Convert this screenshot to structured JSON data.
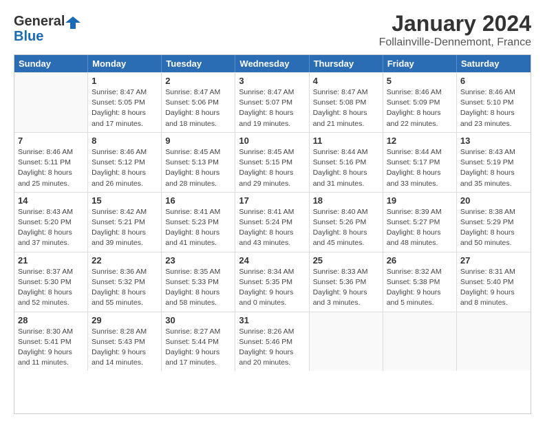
{
  "logo": {
    "general": "General",
    "blue": "Blue"
  },
  "title": "January 2024",
  "subtitle": "Follainville-Dennemont, France",
  "days": [
    "Sunday",
    "Monday",
    "Tuesday",
    "Wednesday",
    "Thursday",
    "Friday",
    "Saturday"
  ],
  "weeks": [
    [
      {
        "num": "",
        "sunrise": "",
        "sunset": "",
        "daylight": ""
      },
      {
        "num": "1",
        "sunrise": "Sunrise: 8:47 AM",
        "sunset": "Sunset: 5:05 PM",
        "daylight": "Daylight: 8 hours and 17 minutes."
      },
      {
        "num": "2",
        "sunrise": "Sunrise: 8:47 AM",
        "sunset": "Sunset: 5:06 PM",
        "daylight": "Daylight: 8 hours and 18 minutes."
      },
      {
        "num": "3",
        "sunrise": "Sunrise: 8:47 AM",
        "sunset": "Sunset: 5:07 PM",
        "daylight": "Daylight: 8 hours and 19 minutes."
      },
      {
        "num": "4",
        "sunrise": "Sunrise: 8:47 AM",
        "sunset": "Sunset: 5:08 PM",
        "daylight": "Daylight: 8 hours and 21 minutes."
      },
      {
        "num": "5",
        "sunrise": "Sunrise: 8:46 AM",
        "sunset": "Sunset: 5:09 PM",
        "daylight": "Daylight: 8 hours and 22 minutes."
      },
      {
        "num": "6",
        "sunrise": "Sunrise: 8:46 AM",
        "sunset": "Sunset: 5:10 PM",
        "daylight": "Daylight: 8 hours and 23 minutes."
      }
    ],
    [
      {
        "num": "7",
        "sunrise": "Sunrise: 8:46 AM",
        "sunset": "Sunset: 5:11 PM",
        "daylight": "Daylight: 8 hours and 25 minutes."
      },
      {
        "num": "8",
        "sunrise": "Sunrise: 8:46 AM",
        "sunset": "Sunset: 5:12 PM",
        "daylight": "Daylight: 8 hours and 26 minutes."
      },
      {
        "num": "9",
        "sunrise": "Sunrise: 8:45 AM",
        "sunset": "Sunset: 5:13 PM",
        "daylight": "Daylight: 8 hours and 28 minutes."
      },
      {
        "num": "10",
        "sunrise": "Sunrise: 8:45 AM",
        "sunset": "Sunset: 5:15 PM",
        "daylight": "Daylight: 8 hours and 29 minutes."
      },
      {
        "num": "11",
        "sunrise": "Sunrise: 8:44 AM",
        "sunset": "Sunset: 5:16 PM",
        "daylight": "Daylight: 8 hours and 31 minutes."
      },
      {
        "num": "12",
        "sunrise": "Sunrise: 8:44 AM",
        "sunset": "Sunset: 5:17 PM",
        "daylight": "Daylight: 8 hours and 33 minutes."
      },
      {
        "num": "13",
        "sunrise": "Sunrise: 8:43 AM",
        "sunset": "Sunset: 5:19 PM",
        "daylight": "Daylight: 8 hours and 35 minutes."
      }
    ],
    [
      {
        "num": "14",
        "sunrise": "Sunrise: 8:43 AM",
        "sunset": "Sunset: 5:20 PM",
        "daylight": "Daylight: 8 hours and 37 minutes."
      },
      {
        "num": "15",
        "sunrise": "Sunrise: 8:42 AM",
        "sunset": "Sunset: 5:21 PM",
        "daylight": "Daylight: 8 hours and 39 minutes."
      },
      {
        "num": "16",
        "sunrise": "Sunrise: 8:41 AM",
        "sunset": "Sunset: 5:23 PM",
        "daylight": "Daylight: 8 hours and 41 minutes."
      },
      {
        "num": "17",
        "sunrise": "Sunrise: 8:41 AM",
        "sunset": "Sunset: 5:24 PM",
        "daylight": "Daylight: 8 hours and 43 minutes."
      },
      {
        "num": "18",
        "sunrise": "Sunrise: 8:40 AM",
        "sunset": "Sunset: 5:26 PM",
        "daylight": "Daylight: 8 hours and 45 minutes."
      },
      {
        "num": "19",
        "sunrise": "Sunrise: 8:39 AM",
        "sunset": "Sunset: 5:27 PM",
        "daylight": "Daylight: 8 hours and 48 minutes."
      },
      {
        "num": "20",
        "sunrise": "Sunrise: 8:38 AM",
        "sunset": "Sunset: 5:29 PM",
        "daylight": "Daylight: 8 hours and 50 minutes."
      }
    ],
    [
      {
        "num": "21",
        "sunrise": "Sunrise: 8:37 AM",
        "sunset": "Sunset: 5:30 PM",
        "daylight": "Daylight: 8 hours and 52 minutes."
      },
      {
        "num": "22",
        "sunrise": "Sunrise: 8:36 AM",
        "sunset": "Sunset: 5:32 PM",
        "daylight": "Daylight: 8 hours and 55 minutes."
      },
      {
        "num": "23",
        "sunrise": "Sunrise: 8:35 AM",
        "sunset": "Sunset: 5:33 PM",
        "daylight": "Daylight: 8 hours and 58 minutes."
      },
      {
        "num": "24",
        "sunrise": "Sunrise: 8:34 AM",
        "sunset": "Sunset: 5:35 PM",
        "daylight": "Daylight: 9 hours and 0 minutes."
      },
      {
        "num": "25",
        "sunrise": "Sunrise: 8:33 AM",
        "sunset": "Sunset: 5:36 PM",
        "daylight": "Daylight: 9 hours and 3 minutes."
      },
      {
        "num": "26",
        "sunrise": "Sunrise: 8:32 AM",
        "sunset": "Sunset: 5:38 PM",
        "daylight": "Daylight: 9 hours and 5 minutes."
      },
      {
        "num": "27",
        "sunrise": "Sunrise: 8:31 AM",
        "sunset": "Sunset: 5:40 PM",
        "daylight": "Daylight: 9 hours and 8 minutes."
      }
    ],
    [
      {
        "num": "28",
        "sunrise": "Sunrise: 8:30 AM",
        "sunset": "Sunset: 5:41 PM",
        "daylight": "Daylight: 9 hours and 11 minutes."
      },
      {
        "num": "29",
        "sunrise": "Sunrise: 8:28 AM",
        "sunset": "Sunset: 5:43 PM",
        "daylight": "Daylight: 9 hours and 14 minutes."
      },
      {
        "num": "30",
        "sunrise": "Sunrise: 8:27 AM",
        "sunset": "Sunset: 5:44 PM",
        "daylight": "Daylight: 9 hours and 17 minutes."
      },
      {
        "num": "31",
        "sunrise": "Sunrise: 8:26 AM",
        "sunset": "Sunset: 5:46 PM",
        "daylight": "Daylight: 9 hours and 20 minutes."
      },
      {
        "num": "",
        "sunrise": "",
        "sunset": "",
        "daylight": ""
      },
      {
        "num": "",
        "sunrise": "",
        "sunset": "",
        "daylight": ""
      },
      {
        "num": "",
        "sunrise": "",
        "sunset": "",
        "daylight": ""
      }
    ]
  ]
}
